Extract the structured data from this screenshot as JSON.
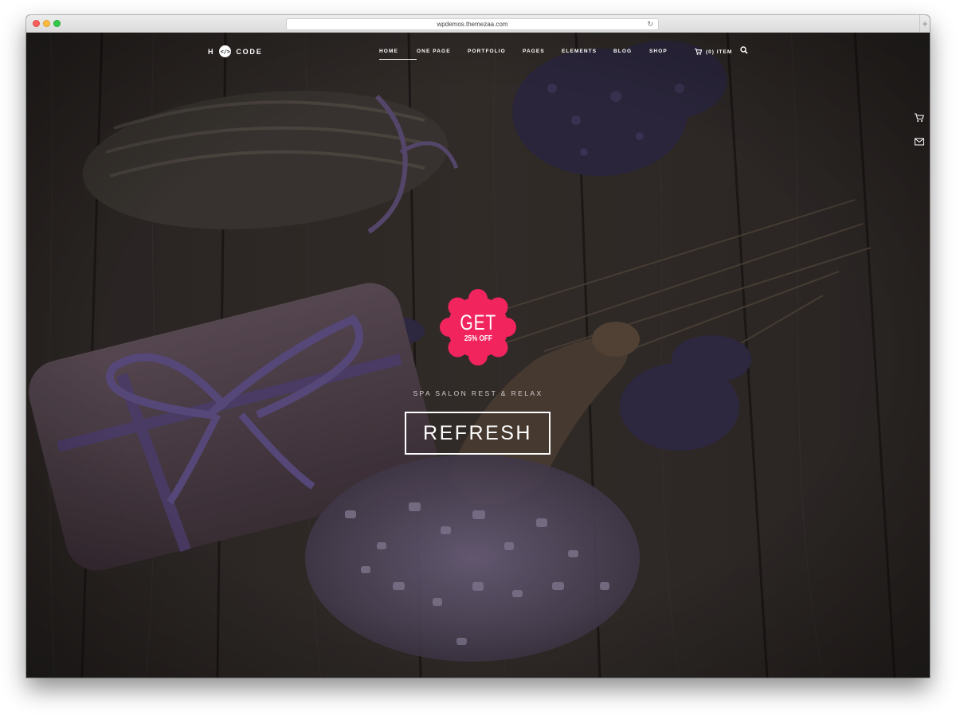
{
  "browser": {
    "url": "wpdemos.themezaa.com",
    "reload_icon": "reload-icon",
    "newtab_label": "+"
  },
  "site": {
    "logo_left": "H",
    "logo_mark": "</>",
    "logo_right": "CODE",
    "nav": [
      {
        "label": "HOME",
        "active": true
      },
      {
        "label": "ONE PAGE"
      },
      {
        "label": "PORTFOLIO"
      },
      {
        "label": "PAGES"
      },
      {
        "label": "ELEMENTS"
      },
      {
        "label": "BLOG"
      },
      {
        "label": "SHOP"
      }
    ],
    "cart_label": "(0) ITEM",
    "icons": [
      "cart-icon",
      "search-icon",
      "side-cart-icon",
      "mail-icon"
    ]
  },
  "hero": {
    "badge_line1": "GET",
    "badge_line2": "25% OFF",
    "badge_color": "#f2245e",
    "tagline": "SPA SALON REST & RELAX",
    "cta_label": "REFRESH"
  }
}
